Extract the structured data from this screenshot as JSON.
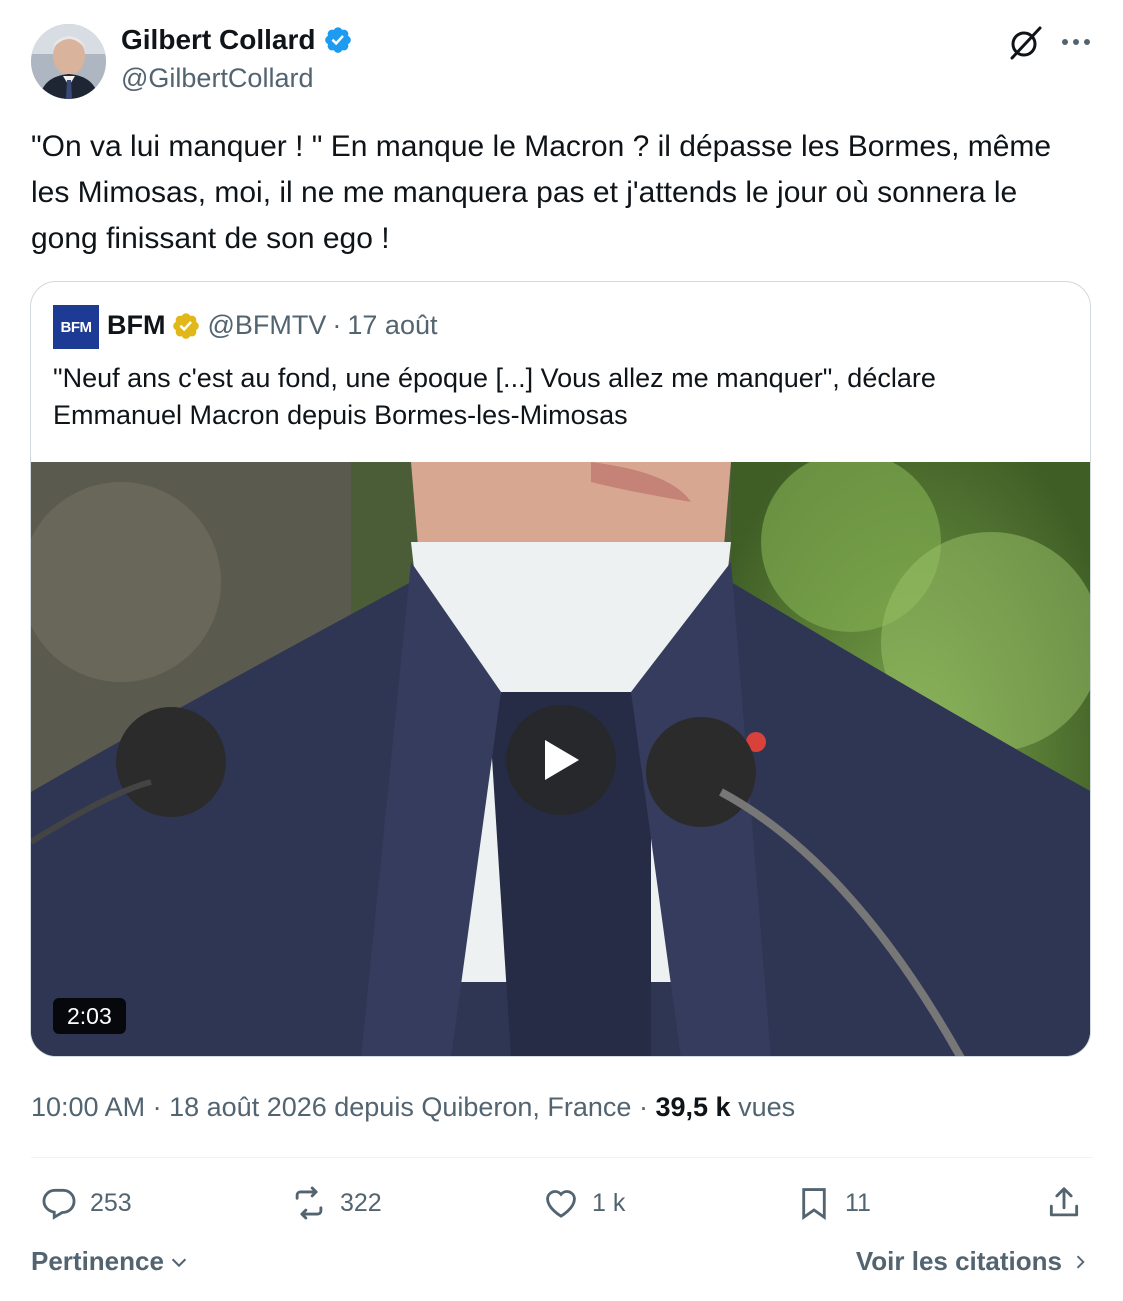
{
  "author": {
    "name": "Gilbert Collard",
    "handle": "@GilbertCollard",
    "verified_color": "#1d9bf0"
  },
  "tweet": {
    "text": "\"On va lui manquer ! \" En manque le Macron ? il dépasse les Bormes, même les Mimosas, moi, il ne me manquera pas et j'attends le jour où sonnera le gong finissant de son ego !"
  },
  "quote": {
    "logo_text": "BFM",
    "name": "BFM",
    "handle": "@BFMTV",
    "separator": "·",
    "date": "17 août",
    "text": "\"Neuf ans c'est au fond, une époque [...] Vous allez me manquer\", déclare Emmanuel Macron depuis Bormes-les-Mimosas",
    "video_duration": "2:03",
    "gold_badge_color": "#e2b719"
  },
  "meta": {
    "time": "10:00 AM",
    "separator": "·",
    "date_location": "18 août 2026 depuis Quiberon, France",
    "views_count": "39,5 k",
    "views_label": "vues"
  },
  "actions": {
    "replies": "253",
    "reposts": "322",
    "likes": "1 k",
    "bookmarks": "11"
  },
  "footer": {
    "sort_label": "Pertinence",
    "citations_label": "Voir les citations"
  },
  "icons": [
    "verified-badge-icon",
    "grok-icon",
    "more-icon",
    "play-icon",
    "reply-icon",
    "repost-icon",
    "like-icon",
    "bookmark-icon",
    "share-icon",
    "chevron-down-icon",
    "chevron-right-icon"
  ]
}
